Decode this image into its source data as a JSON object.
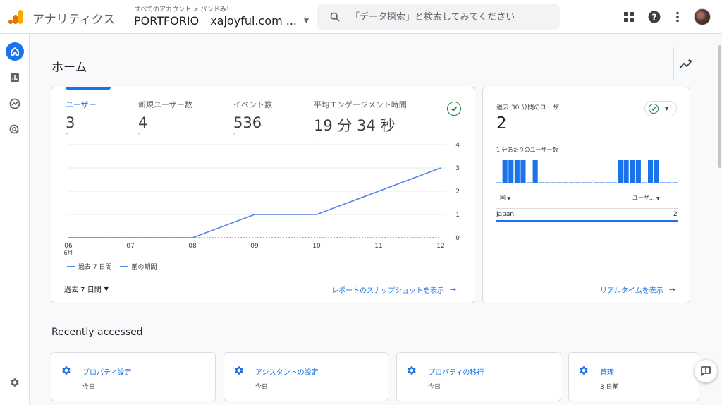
{
  "header": {
    "app_title": "アナリティクス",
    "breadcrumb": "すべてのアカウント > パンドみ！",
    "property": "PORTFORIO",
    "account": "xajoyful.com ...",
    "search_placeholder": "「データ探索」と検索してみてください",
    "icons": [
      "apps-grid-icon",
      "help-icon",
      "more-vert-icon"
    ]
  },
  "rail": {
    "items": [
      "home-icon",
      "reports-icon",
      "explore-icon",
      "advertising-icon"
    ],
    "active": "home-icon",
    "bottom": "settings-icon"
  },
  "page": {
    "title": "ホーム"
  },
  "overview": {
    "metrics": [
      {
        "label": "ユーザー",
        "value": "3",
        "change": "-"
      },
      {
        "label": "新規ユーザー数",
        "value": "4",
        "change": "-"
      },
      {
        "label": "イベント数",
        "value": "536",
        "change": "-"
      },
      {
        "label": "平均エンゲージメント時間",
        "value": "19 分 34 秒",
        "change": "-"
      }
    ],
    "legend_current": "過去 7 日間",
    "legend_previous": "前の期間",
    "date_range": "過去 7 日間",
    "link": "レポートのスナップショットを表示",
    "series_color": "#4f86e3"
  },
  "chart_data": {
    "type": "line",
    "x": [
      "06",
      "07",
      "08",
      "09",
      "10",
      "11",
      "12"
    ],
    "x_sub": "6月",
    "series": [
      {
        "name": "過去 7 日間",
        "values": [
          0,
          0,
          0,
          1,
          1,
          2,
          3
        ]
      },
      {
        "name": "前の期間",
        "values": [
          0,
          0,
          0,
          0,
          0,
          0,
          0
        ]
      }
    ],
    "y_ticks": [
      0,
      1,
      2,
      3,
      4
    ],
    "ylim": [
      0,
      4
    ],
    "grid": true
  },
  "realtime": {
    "title": "過去 30 分間のユーザー",
    "value": "2",
    "sub_title": "1 分あたりのユーザー数",
    "per_minute": [
      0,
      1,
      1,
      1,
      1,
      0,
      1,
      0,
      0,
      0,
      0,
      0,
      0,
      0,
      0,
      0,
      0,
      0,
      0,
      0,
      1,
      1,
      1,
      1,
      0,
      1,
      1,
      0,
      0,
      0
    ],
    "col_left": "国",
    "col_right": "ユーザ...",
    "rows": [
      {
        "country": "Japan",
        "users": "2"
      }
    ],
    "link": "リアルタイムを表示"
  },
  "recent": {
    "title": "Recently accessed",
    "items": [
      {
        "name": "プロパティ設定",
        "when": "今日"
      },
      {
        "name": "アシスタントの設定",
        "when": "今日"
      },
      {
        "name": "プロパティの移行",
        "when": "今日"
      },
      {
        "name": "管理",
        "when": "3 日前"
      }
    ]
  }
}
